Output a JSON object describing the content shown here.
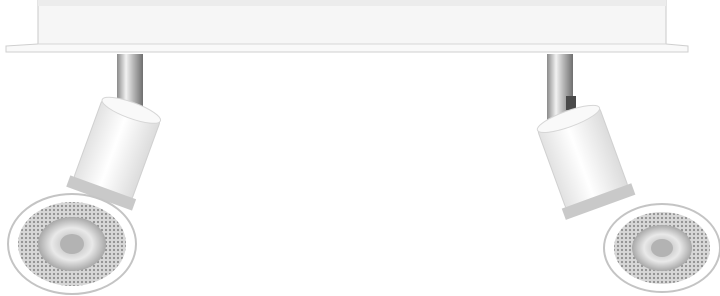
{
  "image": {
    "subject": "two-spot-ceiling-light-fixture",
    "colors": {
      "background": "#ffffff",
      "body_white": "#f7f7f7",
      "body_shade": "#d9d9d9",
      "chrome_light": "#e6e6e6",
      "chrome_dark": "#7a7a7a",
      "bulb_glass": "#cfcfcf",
      "bulb_core": "#9a9a9a"
    }
  }
}
